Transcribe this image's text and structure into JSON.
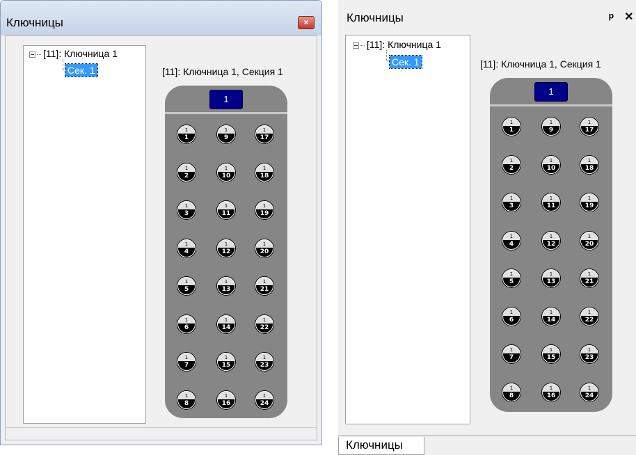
{
  "panels": [
    {
      "title": "Ключницы",
      "tree": {
        "root_label": "[11]: Ключница 1",
        "child_label": "Сек. 1"
      },
      "section_title": "[11]: Ключница 1, Секция 1",
      "cabinet_number": "1"
    },
    {
      "title": "Ключницы",
      "pin_glyph": "ᵖ",
      "close_glyph": "×",
      "tree": {
        "root_label": "[11]: Ключница 1",
        "child_label": "Сек. 1"
      },
      "section_title": "[11]: Ключница 1, Секция 1",
      "cabinet_number": "1",
      "tab_label": "Ключницы"
    }
  ],
  "close_glyph": "×",
  "pin_glyph": "ᵖ",
  "key_top_label": "1",
  "keys": [
    [
      "1",
      "9",
      "17"
    ],
    [
      "2",
      "10",
      "18"
    ],
    [
      "3",
      "11",
      "19"
    ],
    [
      "4",
      "12",
      "20"
    ],
    [
      "5",
      "13",
      "21"
    ],
    [
      "6",
      "14",
      "22"
    ],
    [
      "7",
      "15",
      "23"
    ],
    [
      "8",
      "16",
      "24"
    ]
  ],
  "colors": {
    "window_bg": "#f0f0f0",
    "cabinet_gray": "#868686",
    "key_black": "#000000",
    "badge_blue": "#000088",
    "selection_blue": "#3399ff"
  }
}
